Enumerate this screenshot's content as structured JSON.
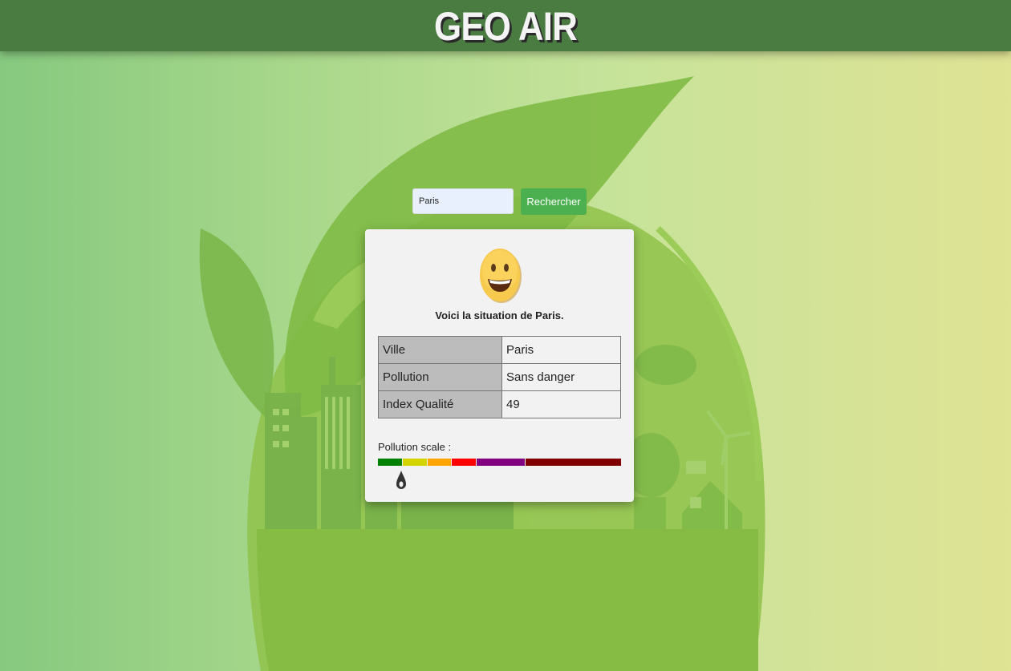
{
  "header": {
    "title": "GEO AIR"
  },
  "search": {
    "value": "Paris",
    "button_label": "Rechercher"
  },
  "result": {
    "emoji": "grinning-face-icon",
    "message": "Voici la situation de Paris.",
    "rows": [
      {
        "label": "Ville",
        "value": "Paris"
      },
      {
        "label": "Pollution",
        "value": "Sans danger"
      },
      {
        "label": "Index Qualité",
        "value": "49"
      }
    ]
  },
  "scale": {
    "label": "Pollution scale :",
    "marker_value": 49,
    "marker_icon": "droplet-icon",
    "segments": [
      {
        "max": 50,
        "color": "#008000"
      },
      {
        "max": 100,
        "color": "#d4d400"
      },
      {
        "max": 150,
        "color": "#ffa500"
      },
      {
        "max": 200,
        "color": "#ff0000"
      },
      {
        "max": 300,
        "color": "#800080"
      },
      {
        "max": 500,
        "color": "#800000"
      }
    ]
  },
  "colors": {
    "header": "#4a7c42",
    "button": "#4cb050",
    "card": "#f2f2f2"
  }
}
